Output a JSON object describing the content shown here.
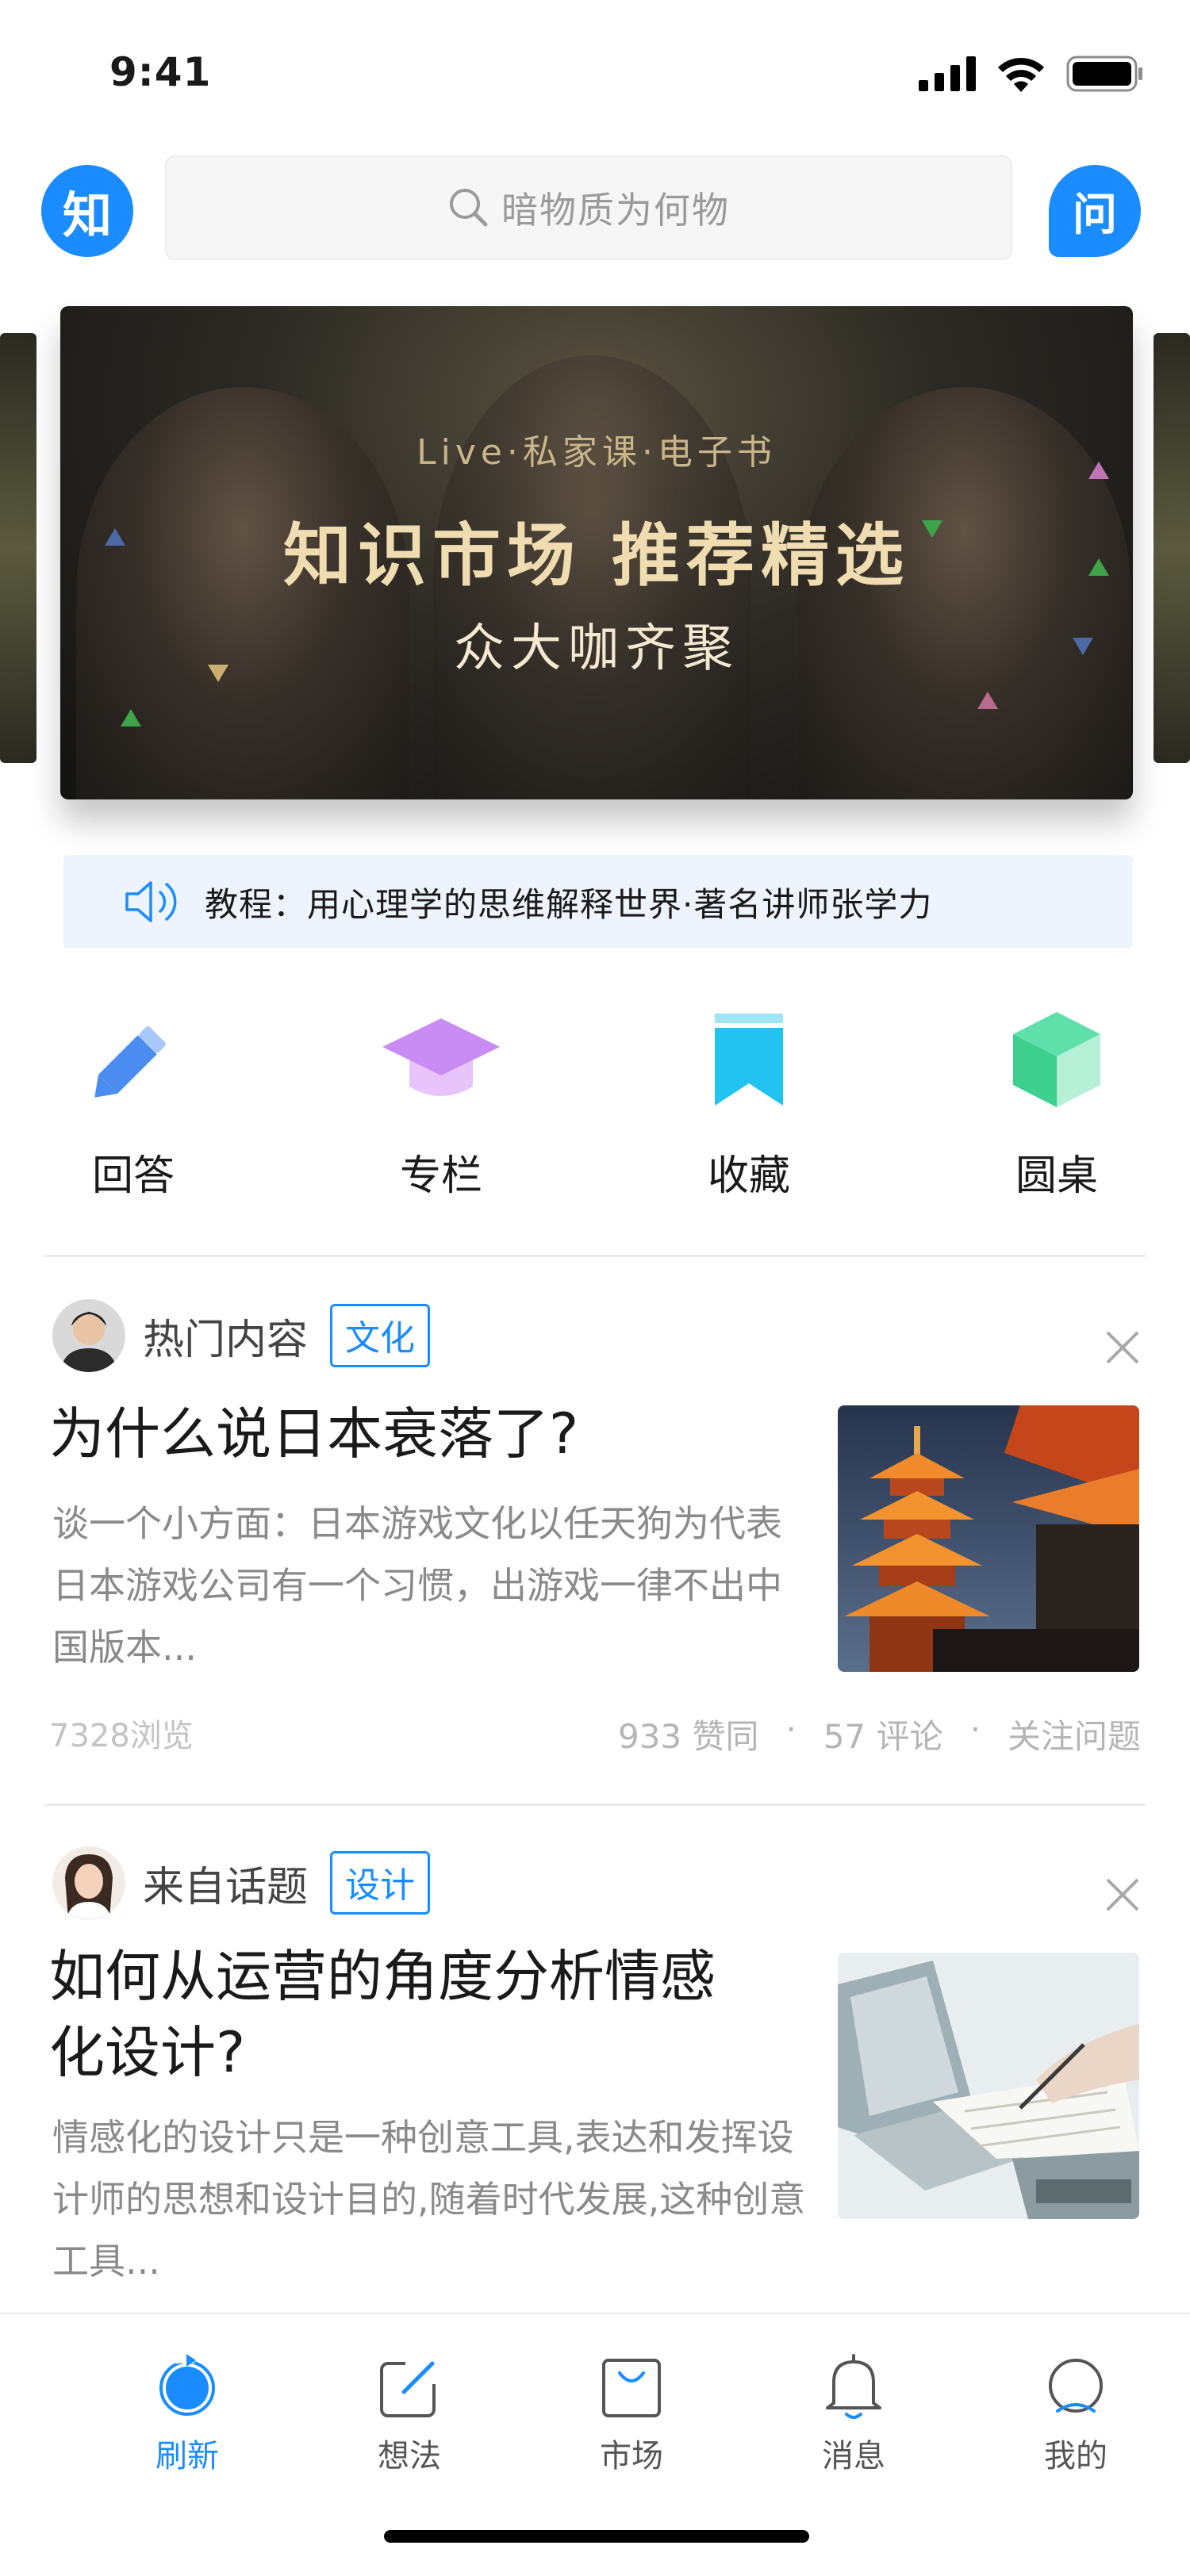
{
  "status_bar": {
    "time": "9:41"
  },
  "header": {
    "logo_text": "知",
    "search_placeholder": "暗物质为何物",
    "ask_text": "问"
  },
  "banner": {
    "subtitle": "Live·私家课·电子书",
    "title": "知识市场  推荐精选",
    "tagline": "众大咖齐聚"
  },
  "notice": {
    "text": "教程：用心理学的思维解释世界·著名讲师张学力"
  },
  "shortcuts": [
    {
      "label": "回答",
      "icon": "pencil-icon",
      "color": "#4a8cf0"
    },
    {
      "label": "专栏",
      "icon": "graduation-cap-icon",
      "color": "#c98cf5"
    },
    {
      "label": "收藏",
      "icon": "bookmark-icon",
      "color": "#22c3f0"
    },
    {
      "label": "圆桌",
      "icon": "cube-icon",
      "color": "#5fdfaa"
    }
  ],
  "feed": [
    {
      "source": "热门内容",
      "tag": "文化",
      "title": "为什么说日本衰落了?",
      "excerpt": "谈一个小方面：日本游戏文化以任天狗为代表日本游戏公司有一个习惯，出游戏一律不出中国版本...",
      "views": "7328浏览",
      "likes": "933 赞同",
      "comments": "57 评论",
      "follow": "关注问题"
    },
    {
      "source": "来自话题",
      "tag": "设计",
      "title_line1": "如何从运营的角度分析情感",
      "title_line2": "化设计?",
      "excerpt": "情感化的设计只是一种创意工具,表达和发挥设计师的思想和设计目的,随着时代发展,这种创意工具..."
    }
  ],
  "tabbar": [
    {
      "label": "刷新",
      "icon": "refresh-icon",
      "active": true
    },
    {
      "label": "想法",
      "icon": "compose-icon",
      "active": false
    },
    {
      "label": "市场",
      "icon": "shopping-bag-icon",
      "active": false
    },
    {
      "label": "消息",
      "icon": "bell-icon",
      "active": false
    },
    {
      "label": "我的",
      "icon": "profile-icon",
      "active": false
    }
  ],
  "colors": {
    "brand_blue": "#1a8cff",
    "banner_gold": "#efdcb0"
  }
}
